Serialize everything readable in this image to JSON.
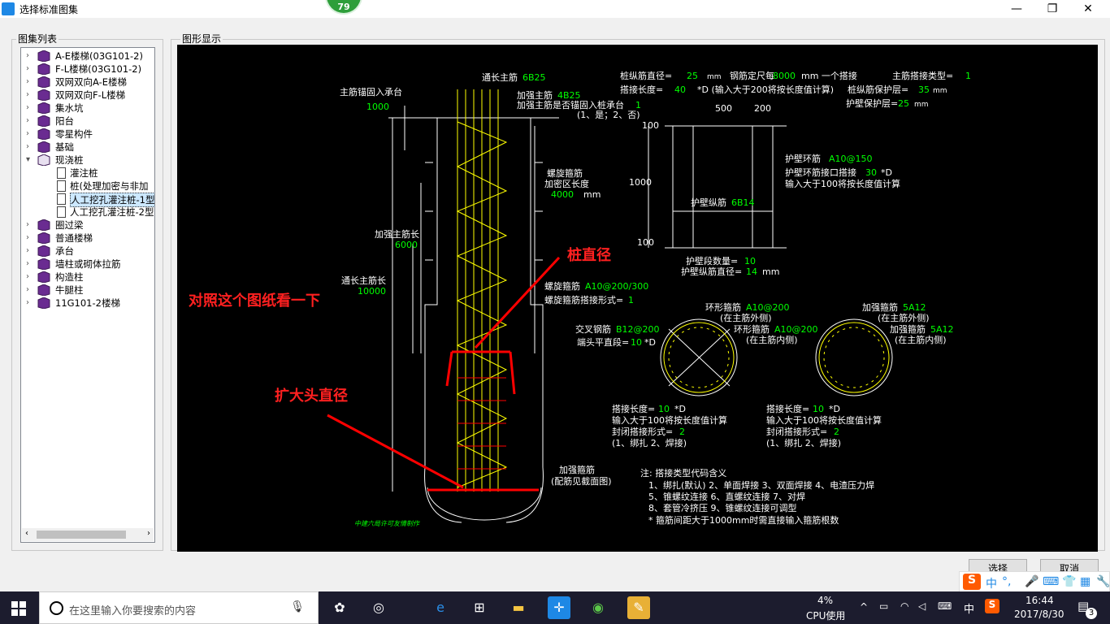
{
  "window": {
    "title": "选择标准图集",
    "badge": "79",
    "min": "—",
    "max": "❐",
    "close": "✕"
  },
  "left_group": {
    "label": "图集列表"
  },
  "right_group": {
    "label": "图形显示"
  },
  "tree": [
    {
      "label": "A-E楼梯(03G101-2)",
      "level": 0
    },
    {
      "label": "F-L楼梯(03G101-2)",
      "level": 0
    },
    {
      "label": "双网双向A-E楼梯",
      "level": 0
    },
    {
      "label": "双网双向F-L楼梯",
      "level": 0
    },
    {
      "label": "集水坑",
      "level": 0
    },
    {
      "label": "阳台",
      "level": 0
    },
    {
      "label": "零星构件",
      "level": 0
    },
    {
      "label": "基础",
      "level": 0
    },
    {
      "label": "现浇桩",
      "level": 0,
      "expanded": true
    },
    {
      "label": "灌注桩",
      "level": 1
    },
    {
      "label": "桩(处理加密与非加",
      "level": 1
    },
    {
      "label": "人工挖孔灌注桩-1型",
      "level": 1,
      "selected": true
    },
    {
      "label": "人工挖孔灌注桩-2型",
      "level": 1
    },
    {
      "label": "圈过梁",
      "level": 0
    },
    {
      "label": "普通楼梯",
      "level": 0
    },
    {
      "label": "承台",
      "level": 0
    },
    {
      "label": "墙柱或砌体拉筋",
      "level": 0
    },
    {
      "label": "构造柱",
      "level": 0
    },
    {
      "label": "牛腿柱",
      "level": 0
    },
    {
      "label": "11G101-2楼梯",
      "level": 0
    }
  ],
  "drawing": {
    "top_left": {
      "l1": "主筋锚固入承台",
      "v1": "1000"
    },
    "top": {
      "t1": "通长主筋",
      "v1": "6B25",
      "t2": "加强主筋",
      "v2": "4B25",
      "t3": "加强主筋是否锚固入桩承台",
      "v3": "1",
      "t4": "(1、是；2、否)"
    },
    "spiral": {
      "t1": "螺旋箍筋",
      "t2": "加密区长度",
      "v": "4000",
      "u": "mm"
    },
    "left_dims": {
      "l1": "加强主筋长",
      "v1": "6000",
      "l2": "通长主筋长",
      "v2": "10000"
    },
    "spiral2": {
      "t1": "螺旋箍筋",
      "v1": "A10@200/300",
      "t2": "螺旋箍筋搭接形式=",
      "v2": "1"
    },
    "bottom": {
      "t1": "加强箍筋",
      "t2": "(配筋见截面图)",
      "credit": "中建六局许可友情制作"
    },
    "top_right": {
      "r1a": "桩纵筋直径=",
      "r1v": "25",
      "r1u": "mm",
      "r1b": "钢筋定尺每",
      "r1v2": "8000",
      "r1c": "mm 一个搭接",
      "r1d": "主筋搭接类型=",
      "r1v3": "1",
      "r2a": "搭接长度=",
      "r2v": "40",
      "r2b": "*D (输入大于200将按长度值计算)",
      "r2c": "桩纵筋保护层=",
      "r2v2": "35",
      "r2u": "mm",
      "r3a": "护壁保护层=",
      "r3v": "25",
      "r3u": "mm"
    },
    "wall": {
      "d500": "500",
      "d200": "200",
      "d100a": "100",
      "d1000": "1000",
      "d100b": "100",
      "ring_t": "护壁环筋",
      "ring_v": "A10@150",
      "lap_t": "护壁环筋接口搭接",
      "lap_v": "30",
      "lap_u": "*D",
      "lap_note": "输入大于100将按长度值计算",
      "long_t": "护壁纵筋",
      "long_v": "6B14",
      "count_t": "护壁段数量=",
      "count_v": "10",
      "dia_t": "护壁纵筋直径=",
      "dia_v": "14",
      "dia_u": "mm"
    },
    "sec1": {
      "ring_t": "环形箍筋",
      "ring_v": "A10@200",
      "ring_n": "(在主筋外侧)",
      "ring2_t": "环形箍筋",
      "ring2_v": "A10@200",
      "ring2_n": "(在主筋内侧)",
      "cross_t": "交叉钢筋",
      "cross_v": "B12@200",
      "end_t": "端头平直段=",
      "end_v": "10",
      "end_u": "*D",
      "lap_t": "搭接长度=",
      "lap_v": "10",
      "lap_u": "*D",
      "n1": "输入大于100将按长度值计算",
      "n2": "封闭搭接形式=",
      "n2v": "2",
      "n3": "(1、绑扎  2、焊接)"
    },
    "sec2": {
      "t1": "加强箍筋",
      "v1": "5A12",
      "n1": "(在主筋外侧)",
      "t2": "加强箍筋",
      "v2": "5A12",
      "n2": "(在主筋内侧)",
      "lap_t": "搭接长度=",
      "lap_v": "10",
      "lap_u": "*D",
      "m1": "输入大于100将按长度值计算",
      "m2": "封闭搭接形式=",
      "m2v": "2",
      "m3": "(1、绑扎  2、焊接)"
    },
    "notes": {
      "title": "注: 搭接类型代码含义",
      "l1": "1、绑扎(默认)    2、单面焊接    3、双面焊接    4、电渣压力焊",
      "l2": "5、锥螺纹连接    6、直螺纹连接    7、对焊",
      "l3": "8、套管冷挤压    9、锥螺纹连接可调型",
      "l4": "* 箍筋间距大于1000mm时需直接输入箍筋根数"
    },
    "annot": {
      "a1": "桩直径",
      "a2": "对照这个图纸看一下",
      "a3": "扩大头直径"
    }
  },
  "buttons": {
    "select": "选择",
    "cancel": "取消"
  },
  "taskbar": {
    "search_placeholder": "在这里输入你要搜索的内容",
    "cpu_pct": "4%",
    "cpu_label": "CPU使用",
    "ime": "中",
    "time": "16:44",
    "date": "2017/8/30",
    "notif": "3"
  },
  "ime_bar": {
    "s": "S",
    "z": "中",
    "dot": "°,"
  },
  "colors": {
    "green": "#00ff00",
    "white": "#ffffff",
    "yellow": "#ffff00",
    "red": "#ff0000",
    "accent": "#1e88e5"
  }
}
